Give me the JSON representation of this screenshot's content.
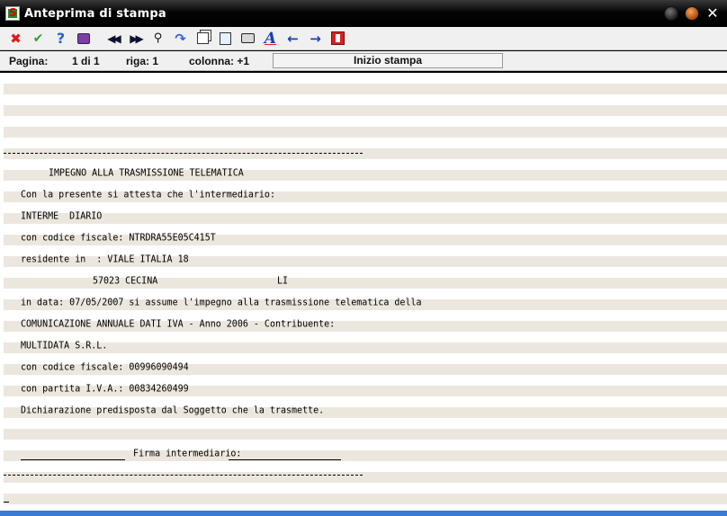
{
  "window": {
    "title": "Anteprima di stampa"
  },
  "toolbar": {
    "icons": [
      "close-icon",
      "confirm-icon",
      "help-icon",
      "book-icon",
      "first-page-icon",
      "last-page-icon",
      "find-icon",
      "redo-icon",
      "copy-icon",
      "zoom-icon",
      "print-icon",
      "font-icon",
      "arrow-left-icon",
      "arrow-right-icon",
      "exit-icon"
    ]
  },
  "status": {
    "page_label": "Pagina:",
    "page_value": "1 di 1",
    "row_label": "riga: 1",
    "column_label": "colonna: +1",
    "message": "Inizio stampa"
  },
  "document": {
    "heading": "IMPEGNO ALLA TRASMISSIONE TELEMATICA",
    "lines": [
      "Con la presente si attesta che l'intermediario:",
      "INTERME  DIARIO",
      "con codice fiscale: NTRDRA55E05C415T",
      "residente in  : VIALE ITALIA 18",
      "57023 CECINA",
      "LI",
      "in data: 07/05/2007 si assume l'impegno alla trasmissione telematica della",
      "COMUNICAZIONE ANNUALE DATI IVA - Anno 2006 - Contribuente:",
      "MULTIDATA S.R.L.",
      "con codice fiscale: 00996090494",
      "con partita I.V.A.: 00834260499",
      "Dichiarazione predisposta dal Soggetto che la trasmette."
    ],
    "signature_label": "Firma intermediario:"
  },
  "colors": {
    "titlebar": "#000000",
    "paper_white": "#ffffff",
    "paper_band": "#ece7de",
    "accent": "#3a7bd5"
  }
}
